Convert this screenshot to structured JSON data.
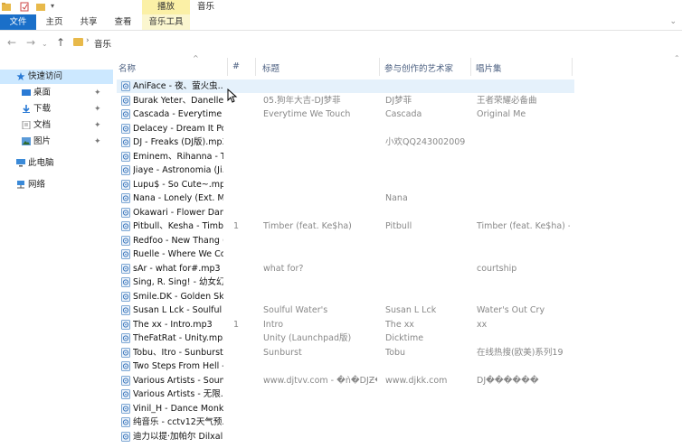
{
  "titlebar": {
    "context_tab": "播放",
    "window_title": "音乐"
  },
  "ribbon": {
    "tabs": [
      "文件",
      "主页",
      "共享",
      "查看",
      "音乐工具"
    ]
  },
  "address": {
    "breadcrumb": "音乐"
  },
  "nav_pane": {
    "items": [
      {
        "label": "快速访问",
        "icon": "star-icon",
        "pinned": false
      },
      {
        "label": "桌面",
        "icon": "desktop-icon",
        "pinned": true
      },
      {
        "label": "下载",
        "icon": "download-icon",
        "pinned": true
      },
      {
        "label": "文档",
        "icon": "document-icon",
        "pinned": true
      },
      {
        "label": "图片",
        "icon": "pictures-icon",
        "pinned": true
      },
      {
        "label": "此电脑",
        "icon": "computer-icon",
        "pinned": false
      },
      {
        "label": "网络",
        "icon": "network-icon",
        "pinned": false
      }
    ]
  },
  "columns": {
    "name": "名称",
    "number": "#",
    "title": "标题",
    "artist": "参与创作的艺术家",
    "album": "唱片集"
  },
  "files": [
    {
      "name": "AniFace - 夜、萤火虫...",
      "number": "",
      "title": "",
      "artist": "",
      "album": ""
    },
    {
      "name": "Burak Yeter、Danelle ...",
      "number": "",
      "title": "05.狗年大吉-DJ梦菲",
      "artist": "DJ梦菲",
      "album": "王者荣耀必备曲"
    },
    {
      "name": "Cascada - Everytime ...",
      "number": "",
      "title": "Everytime We Touch",
      "artist": "Cascada",
      "album": "Original Me"
    },
    {
      "name": "Delacey - Dream It Po...",
      "number": "",
      "title": "",
      "artist": "",
      "album": ""
    },
    {
      "name": "DJ - Freaks (DJ版).mp3",
      "number": "",
      "title": "",
      "artist": "小欢QQ243002009",
      "album": ""
    },
    {
      "name": "Eminem、Rihanna - T...",
      "number": "",
      "title": "",
      "artist": "",
      "album": ""
    },
    {
      "name": "Jiaye - Astronomia (Ji...",
      "number": "",
      "title": "",
      "artist": "",
      "album": ""
    },
    {
      "name": "Lupu$ - So Cute~.mp3",
      "number": "",
      "title": "",
      "artist": "",
      "album": ""
    },
    {
      "name": "Nana - Lonely (Ext. Mi...",
      "number": "",
      "title": "",
      "artist": "Nana",
      "album": ""
    },
    {
      "name": "Okawari - Flower Dan...",
      "number": "",
      "title": "",
      "artist": "",
      "album": ""
    },
    {
      "name": "Pitbull、Kesha - Timb...",
      "number": "1",
      "title": "Timber (feat. Ke$ha)",
      "artist": "Pitbull",
      "album": "Timber (feat. Ke$ha) - ..."
    },
    {
      "name": "Redfoo - New Thang (...",
      "number": "",
      "title": "",
      "artist": "",
      "album": ""
    },
    {
      "name": "Ruelle - Where We Co...",
      "number": "",
      "title": "",
      "artist": "",
      "album": ""
    },
    {
      "name": "sAr - what for#.mp3",
      "number": "",
      "title": "what for?",
      "artist": "",
      "album": "courtship"
    },
    {
      "name": "Sing, R. Sing! - 幼女幻...",
      "number": "",
      "title": "",
      "artist": "",
      "album": ""
    },
    {
      "name": "Smile.DK - Golden Sk...",
      "number": "",
      "title": "",
      "artist": "",
      "album": ""
    },
    {
      "name": "Susan L Lck - Soulful ...",
      "number": "",
      "title": "Soulful Water's",
      "artist": "Susan L Lck",
      "album": "Water's Out Cry"
    },
    {
      "name": "The xx - Intro.mp3",
      "number": "1",
      "title": "Intro",
      "artist": "The xx",
      "album": "xx"
    },
    {
      "name": "TheFatRat - Unity.mp3",
      "number": "",
      "title": "Unity (Launchpad版)",
      "artist": "Dicktime",
      "album": ""
    },
    {
      "name": "Tobu、Itro - Sunburst...",
      "number": "",
      "title": "Sunburst",
      "artist": "Tobu",
      "album": "在线热搜(欧美)系列19"
    },
    {
      "name": "Two Steps From Hell - ...",
      "number": "",
      "title": "",
      "artist": "",
      "album": ""
    },
    {
      "name": "Various Artists - Soun...",
      "number": "",
      "title": "www.djtvv.com - �ǹ�DJƵ�",
      "artist": "www.djkk.com",
      "album": "DJ������"
    },
    {
      "name": "Various Artists - 无限...",
      "number": "",
      "title": "",
      "artist": "",
      "album": ""
    },
    {
      "name": "Vinil_H - Dance Monk...",
      "number": "",
      "title": "",
      "artist": "",
      "album": ""
    },
    {
      "name": "纯音乐 - cctv12天气预...",
      "number": "",
      "title": "",
      "artist": "",
      "album": ""
    },
    {
      "name": "迪力以提·加帕尔 Dilxal...",
      "number": "",
      "title": "",
      "artist": "",
      "album": ""
    }
  ],
  "colors": {
    "file_tab": "#1a6fc9",
    "context_tab": "#fbf0a6",
    "selection": "#cce8ff",
    "hover": "#e5f1fb",
    "header_text": "#4b5f80"
  }
}
